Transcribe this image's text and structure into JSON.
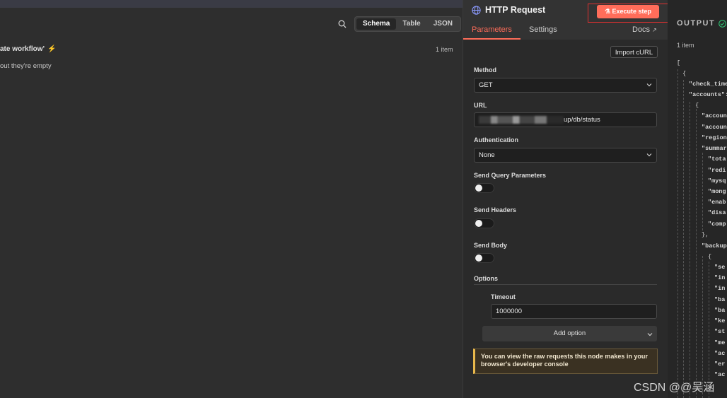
{
  "left": {
    "views": [
      "Schema",
      "Table",
      "JSON"
    ],
    "workflow_text": "ate workflow'",
    "empty_text": "out they're empty",
    "item_count": "1 item"
  },
  "panel": {
    "title": "HTTP Request",
    "execute_label": "Execute step",
    "tabs": [
      "Parameters",
      "Settings"
    ],
    "docs_label": "Docs",
    "import_label": "Import cURL",
    "method_label": "Method",
    "method_value": "GET",
    "url_label": "URL",
    "url_suffix": "up/db/status",
    "auth_label": "Authentication",
    "auth_value": "None",
    "query_label": "Send Query Parameters",
    "headers_label": "Send Headers",
    "body_label": "Send Body",
    "options_label": "Options",
    "timeout_label": "Timeout",
    "timeout_value": "1000000",
    "add_option_label": "Add option",
    "notice": "You can view the raw requests this node makes in your browser's developer console",
    "accent": "#ff6d5a"
  },
  "output": {
    "title": "OUTPUT",
    "item_count": "1 item",
    "json_lines": [
      "[",
      "{",
      "\"check_time",
      "\"accounts\":",
      "{",
      "\"accoun",
      "\"accoun",
      "\"region",
      "\"summar",
      "\"tota",
      "\"redi",
      "\"mysq",
      "\"mong",
      "\"enab",
      "\"disa",
      "\"comp",
      "},",
      "\"backup",
      "{",
      "\"se",
      "\"in",
      "\"in",
      "\"ba",
      "\"ba",
      "\"ke",
      "\"st",
      "\"me",
      "\"ac",
      "\"er",
      "\"ac"
    ]
  },
  "watermark": "CSDN @@吴涵"
}
